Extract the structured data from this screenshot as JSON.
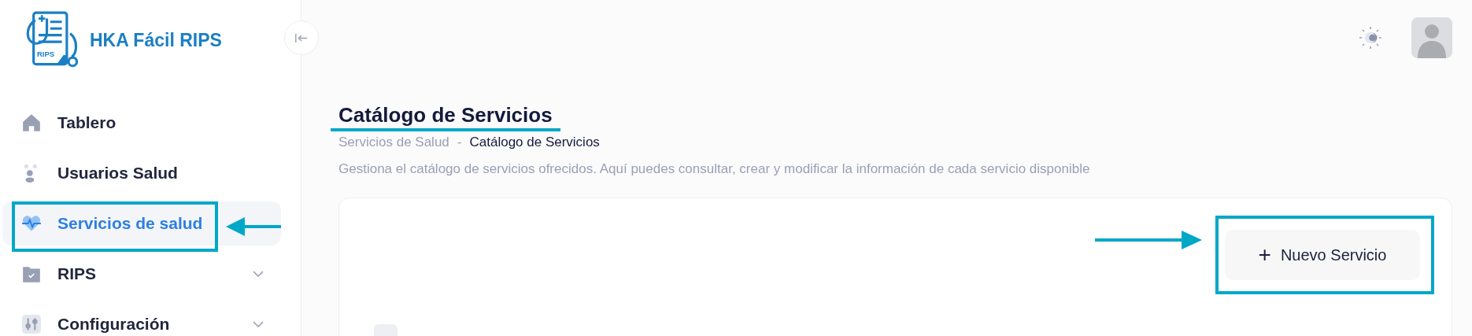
{
  "app": {
    "name": "HKA Fácil RIPS",
    "logo_badge": "RIPS"
  },
  "sidebar": {
    "items": [
      {
        "label": "Tablero",
        "selected": false,
        "expandable": false
      },
      {
        "label": "Usuarios Salud",
        "selected": false,
        "expandable": false
      },
      {
        "label": "Servicios de salud",
        "selected": true,
        "expandable": false
      },
      {
        "label": "RIPS",
        "selected": false,
        "expandable": true
      },
      {
        "label": "Configuración",
        "selected": false,
        "expandable": true
      }
    ]
  },
  "page": {
    "title": "Catálogo de Servicios",
    "breadcrumb": [
      {
        "label": "Servicios de Salud",
        "current": false
      },
      {
        "label": "Catálogo de Servicios",
        "current": true
      }
    ],
    "breadcrumb_separator": "-",
    "description": "Gestiona el catálogo de servicios ofrecidos. Aquí puedes consultar, crear y modificar la información de cada servicio disponible",
    "new_button": {
      "icon": "+",
      "label": "Nuevo Servicio"
    }
  }
}
